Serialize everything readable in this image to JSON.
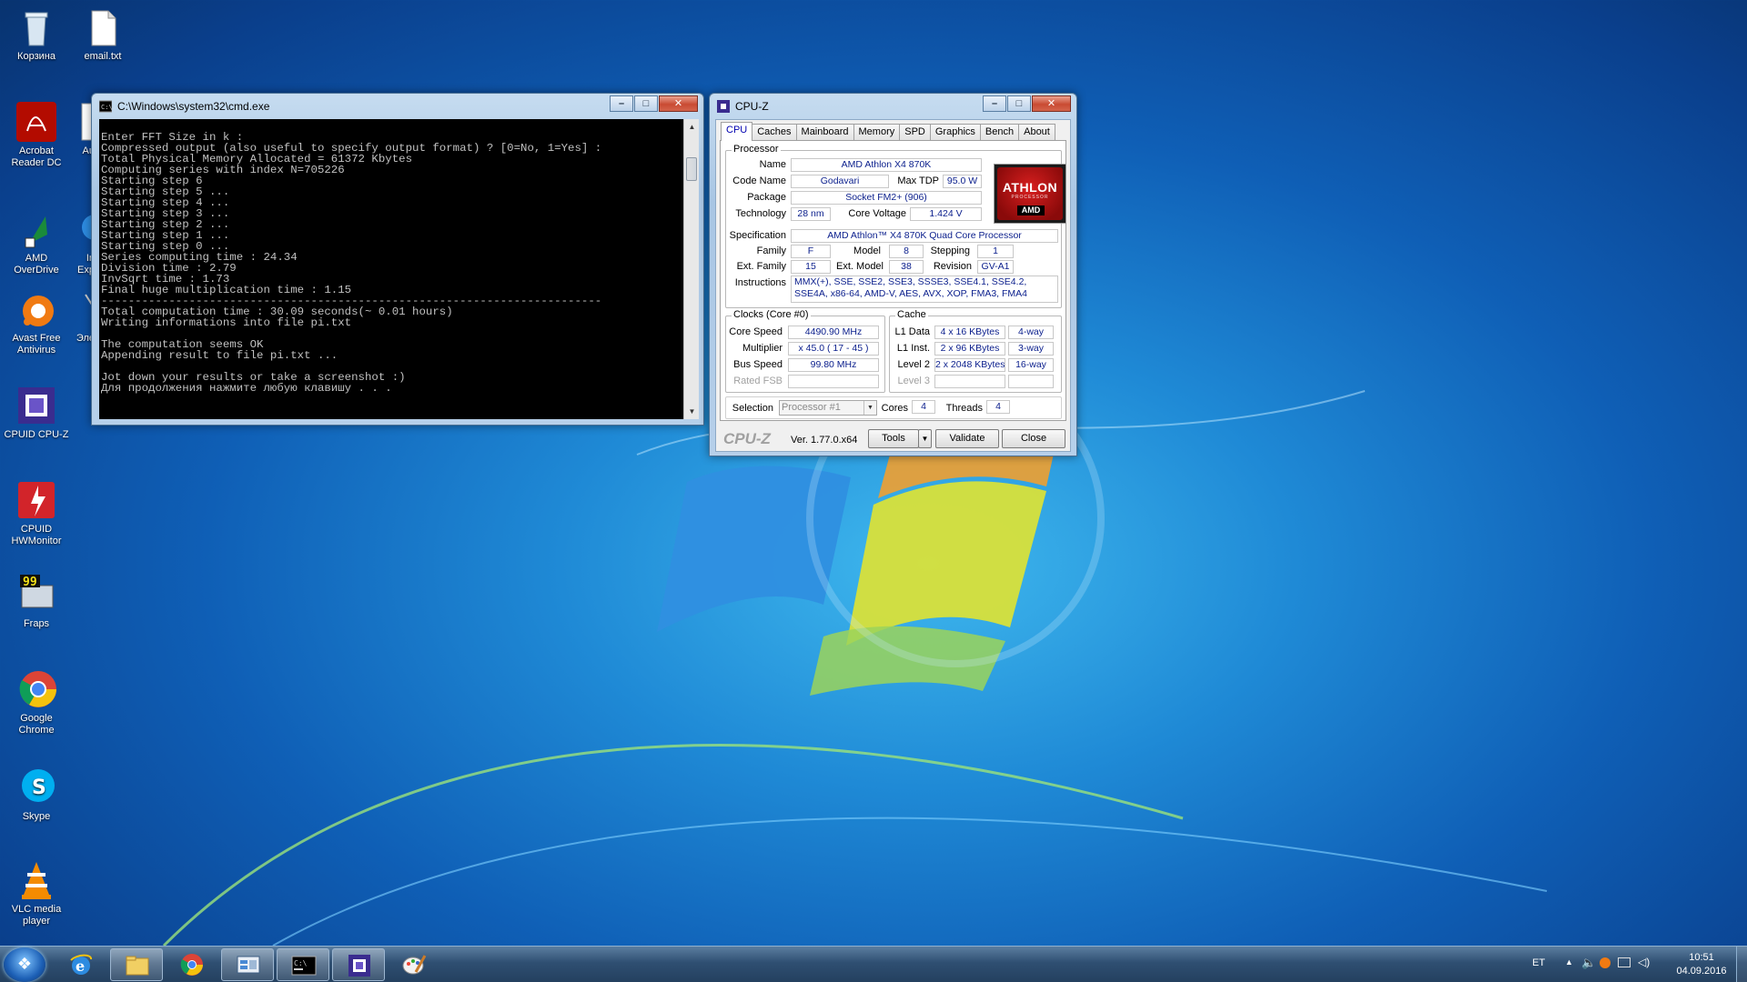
{
  "desktop": {
    "icons": [
      {
        "name": "recycle-bin",
        "label": "Корзина"
      },
      {
        "name": "email-txt",
        "label": "email.txt"
      },
      {
        "name": "acrobat-reader",
        "label": "Acrobat\nReader DC"
      },
      {
        "name": "amd-overdrive",
        "label": "AMD\nOverDrive"
      },
      {
        "name": "avast",
        "label": "Avast Free\nAntivirus"
      },
      {
        "name": "cpuid-cpuz",
        "label": "CPUID CPU-Z"
      },
      {
        "name": "cpuid-hwmonitor",
        "label": "CPUID\nHWMonitor"
      },
      {
        "name": "fraps",
        "label": "Fraps"
      },
      {
        "name": "google-chrome",
        "label": "Google\nChrome"
      },
      {
        "name": "skype",
        "label": "Skype"
      },
      {
        "name": "vlc",
        "label": "VLC media\nplayer"
      },
      {
        "name": "partial-au",
        "label": "Au"
      },
      {
        "name": "partial-inexp",
        "label": "In\nExp"
      },
      {
        "name": "partial-ele",
        "label": "Эле\n-"
      }
    ]
  },
  "cmd": {
    "title": "C:\\Windows\\system32\\cmd.exe",
    "lines": [
      "Enter FFT Size in k :",
      "Compressed output (also useful to specify output format) ? [0=No, 1=Yes] :",
      "Total Physical Memory Allocated = 61372 Kbytes",
      "Computing series with index N=705226",
      "Starting step 6",
      "Starting step 5 ...",
      "Starting step 4 ...",
      "Starting step 3 ...",
      "Starting step 2 ...",
      "Starting step 1 ...",
      "Starting step 0 ...",
      "Series computing time : 24.34",
      "Division time : 2.79",
      "InvSqrt time : 1.73",
      "Final huge multiplication time : 1.15",
      "--------------------------------------------------------------------------",
      "Total computation time : 30.09 seconds(~ 0.01 hours)",
      "Writing informations into file pi.txt",
      "",
      "The computation seems OK",
      "Appending result to file pi.txt ...",
      "",
      "Jot down your results or take a screenshot :)",
      "Для продолжения нажмите любую клавишу . . ."
    ]
  },
  "cpuz": {
    "title": "CPU-Z",
    "tabs": [
      "CPU",
      "Caches",
      "Mainboard",
      "Memory",
      "SPD",
      "Graphics",
      "Bench",
      "About"
    ],
    "processor": {
      "group": "Processor",
      "name_label": "Name",
      "name": "AMD Athlon X4 870K",
      "codename_label": "Code Name",
      "codename": "Godavari",
      "maxtdp_label": "Max TDP",
      "maxtdp": "95.0 W",
      "package_label": "Package",
      "package": "Socket FM2+ (906)",
      "technology_label": "Technology",
      "technology": "28 nm",
      "corevoltage_label": "Core Voltage",
      "corevoltage": "1.424 V",
      "spec_label": "Specification",
      "spec": "AMD Athlon™ X4 870K Quad Core Processor",
      "family_label": "Family",
      "family": "F",
      "model_label": "Model",
      "model": "8",
      "stepping_label": "Stepping",
      "stepping": "1",
      "extfamily_label": "Ext. Family",
      "extfamily": "15",
      "extmodel_label": "Ext. Model",
      "extmodel": "38",
      "revision_label": "Revision",
      "revision": "GV-A1",
      "instructions_label": "Instructions",
      "instructions": "MMX(+), SSE, SSE2, SSE3, SSSE3, SSE4.1, SSE4.2, SSE4A, x86-64, AMD-V, AES, AVX, XOP, FMA3, FMA4",
      "logo_text": "ATHLON",
      "logo_sub": "PROCESSOR",
      "logo_brand": "AMD"
    },
    "clocks": {
      "group": "Clocks (Core #0)",
      "corespeed_label": "Core Speed",
      "corespeed": "4490.90 MHz",
      "multiplier_label": "Multiplier",
      "multiplier": "x 45.0 ( 17 - 45 )",
      "busspeed_label": "Bus Speed",
      "busspeed": "99.80 MHz",
      "ratedfsb_label": "Rated FSB",
      "ratedfsb": ""
    },
    "cache": {
      "group": "Cache",
      "l1data_label": "L1 Data",
      "l1data": "4 x 16 KBytes",
      "l1data_way": "4-way",
      "l1inst_label": "L1 Inst.",
      "l1inst": "2 x 96 KBytes",
      "l1inst_way": "3-way",
      "level2_label": "Level 2",
      "level2": "2 x 2048 KBytes",
      "level2_way": "16-way",
      "level3_label": "Level 3",
      "level3": "",
      "level3_way": ""
    },
    "selection_label": "Selection",
    "selection": "Processor #1",
    "cores_label": "Cores",
    "cores": "4",
    "threads_label": "Threads",
    "threads": "4",
    "brand": "CPU-Z",
    "version": "Ver. 1.77.0.x64",
    "tools_label": "Tools",
    "validate_label": "Validate",
    "close_label": "Close"
  },
  "taskbar": {
    "items": [
      "internet-explorer",
      "file-explorer",
      "google-chrome",
      "control-panel",
      "cmd",
      "cpu-z",
      "paint"
    ],
    "lang": "ET",
    "time": "10:51",
    "date": "04.09.2016"
  }
}
